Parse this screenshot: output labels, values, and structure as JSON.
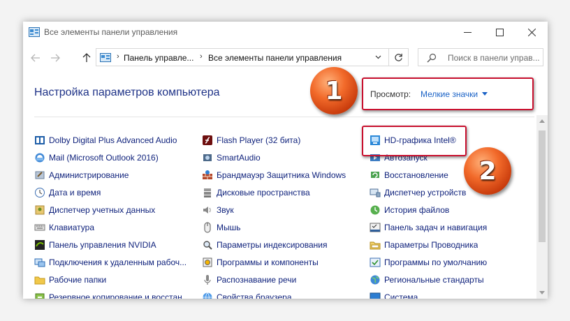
{
  "window": {
    "title": "Все элементы панели управления"
  },
  "address": {
    "crumbs": [
      "Панель управле...",
      "Все элементы панели управления"
    ]
  },
  "search": {
    "placeholder": "Поиск в панели управ..."
  },
  "header": {
    "title": "Настройка параметров компьютера",
    "view_label": "Просмотр:",
    "view_value": "Мелкие значки"
  },
  "badges": [
    "1",
    "2"
  ],
  "columns": [
    [
      {
        "label": "Dolby Digital Plus Advanced Audio",
        "icon": "dolby-icon"
      },
      {
        "label": "Mail (Microsoft Outlook 2016)",
        "icon": "mail-icon"
      },
      {
        "label": "Администрирование",
        "icon": "admin-tools-icon"
      },
      {
        "label": "Дата и время",
        "icon": "clock-icon"
      },
      {
        "label": "Диспетчер учетных данных",
        "icon": "credential-icon"
      },
      {
        "label": "Клавиатура",
        "icon": "keyboard-icon"
      },
      {
        "label": "Панель управления NVIDIA",
        "icon": "nvidia-icon"
      },
      {
        "label": "Подключения к удаленным рабоч...",
        "icon": "remote-icon"
      },
      {
        "label": "Рабочие папки",
        "icon": "folder-icon"
      },
      {
        "label": "Резервное копирование и восстан...",
        "icon": "backup-icon"
      }
    ],
    [
      {
        "label": "Flash Player (32 бита)",
        "icon": "flash-icon"
      },
      {
        "label": "SmartAudio",
        "icon": "audio-icon"
      },
      {
        "label": "Брандмауэр Защитника Windows",
        "icon": "firewall-icon"
      },
      {
        "label": "Дисковые пространства",
        "icon": "storage-icon"
      },
      {
        "label": "Звук",
        "icon": "speaker-icon"
      },
      {
        "label": "Мышь",
        "icon": "mouse-icon"
      },
      {
        "label": "Параметры индексирования",
        "icon": "indexing-icon"
      },
      {
        "label": "Программы и компоненты",
        "icon": "programs-icon"
      },
      {
        "label": "Распознавание речи",
        "icon": "microphone-icon"
      },
      {
        "label": "Свойства браузера",
        "icon": "browser-icon"
      }
    ],
    [
      {
        "label": "HD-графика Intel®",
        "icon": "intel-graphics-icon"
      },
      {
        "label": "Автозапуск",
        "icon": "autoplay-icon"
      },
      {
        "label": "Восстановление",
        "icon": "recovery-icon"
      },
      {
        "label": "Диспетчер устройств",
        "icon": "device-manager-icon"
      },
      {
        "label": "История файлов",
        "icon": "file-history-icon"
      },
      {
        "label": "Панель задач и навигация",
        "icon": "taskbar-icon"
      },
      {
        "label": "Параметры Проводника",
        "icon": "explorer-options-icon"
      },
      {
        "label": "Программы по умолчанию",
        "icon": "default-programs-icon"
      },
      {
        "label": "Региональные стандарты",
        "icon": "region-icon"
      },
      {
        "label": "Система",
        "icon": "system-icon"
      }
    ]
  ],
  "colors": {
    "accent_link": "#0c1f7a",
    "heading": "#1e3287",
    "highlight": "#c8102e",
    "badge": "#e2561a"
  }
}
